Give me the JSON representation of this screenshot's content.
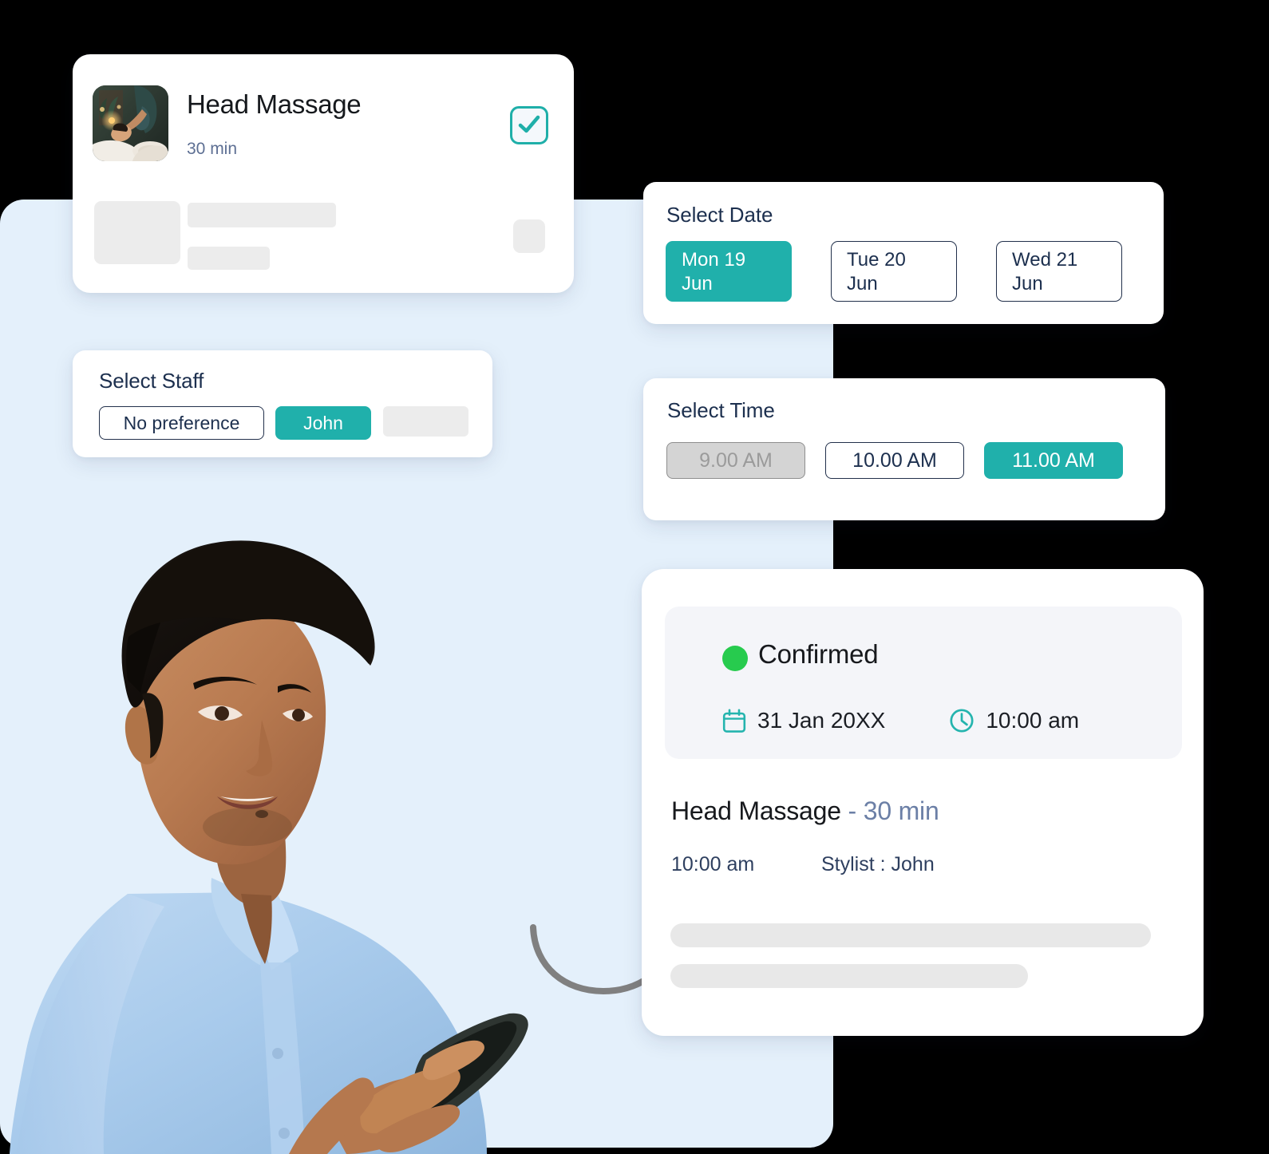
{
  "service_card": {
    "title": "Head Massage",
    "duration": "30 min",
    "thumbnail_icon": "spa-massage-photo",
    "checkbox_icon": "checkmark-icon",
    "selected": true
  },
  "staff_panel": {
    "label": "Select Staff",
    "options": [
      {
        "label": "No preference",
        "state": "outline"
      },
      {
        "label": "John",
        "state": "selected"
      },
      {
        "label": "",
        "state": "placeholder"
      }
    ]
  },
  "date_panel": {
    "label": "Select Date",
    "options": [
      {
        "label": "Mon 19\nJun",
        "state": "selected"
      },
      {
        "label": "Tue 20\nJun",
        "state": "outline"
      },
      {
        "label": "Wed 21\nJun",
        "state": "outline"
      }
    ]
  },
  "time_panel": {
    "label": "Select Time",
    "options": [
      {
        "label": "9.00 AM",
        "state": "disabled"
      },
      {
        "label": "10.00 AM",
        "state": "outline"
      },
      {
        "label": "11.00 AM",
        "state": "selected"
      }
    ]
  },
  "confirmation_card": {
    "status": "Confirmed",
    "status_dot_color": "#27CB4E",
    "date": "31 Jan 20XX",
    "date_icon": "calendar-icon",
    "time": "10:00 am",
    "time_icon": "clock-icon",
    "service_name": "Head Massage",
    "separator": "-",
    "service_duration": "30 min",
    "appointment_time": "10:00 am",
    "stylist": "Stylist : John"
  },
  "colors": {
    "accent_teal": "#20B0AB",
    "navy_text": "#1C2F4E",
    "backdrop_blue": "#E4F0FB",
    "status_green": "#27CB4E",
    "skeleton_gray": "#ECECEC"
  },
  "illustration": {
    "person_photo": "man-using-smartphone",
    "arrow_icon": "curved-arrow-icon"
  }
}
